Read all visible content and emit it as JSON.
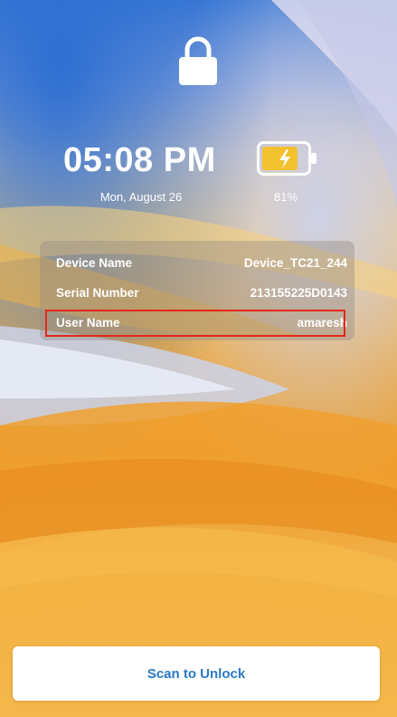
{
  "lockscreen": {
    "time": "05:08 PM",
    "date": "Mon, August 26",
    "battery_percent": "81%",
    "battery_level": 0.81,
    "battery_charging": true
  },
  "device_info": {
    "rows": [
      {
        "label": "Device Name",
        "value": "Device_TC21_244"
      },
      {
        "label": "Serial Number",
        "value": "213155225D0143"
      },
      {
        "label": "User Name",
        "value": "amaresh"
      }
    ]
  },
  "actions": {
    "scan_label": "Scan to Unlock"
  },
  "colors": {
    "accent": "#2a79c6",
    "highlight": "#e3271c",
    "battery_fill": "#f2c12e"
  },
  "icons": {
    "lock": "lock-icon",
    "battery": "battery-charging-icon"
  }
}
